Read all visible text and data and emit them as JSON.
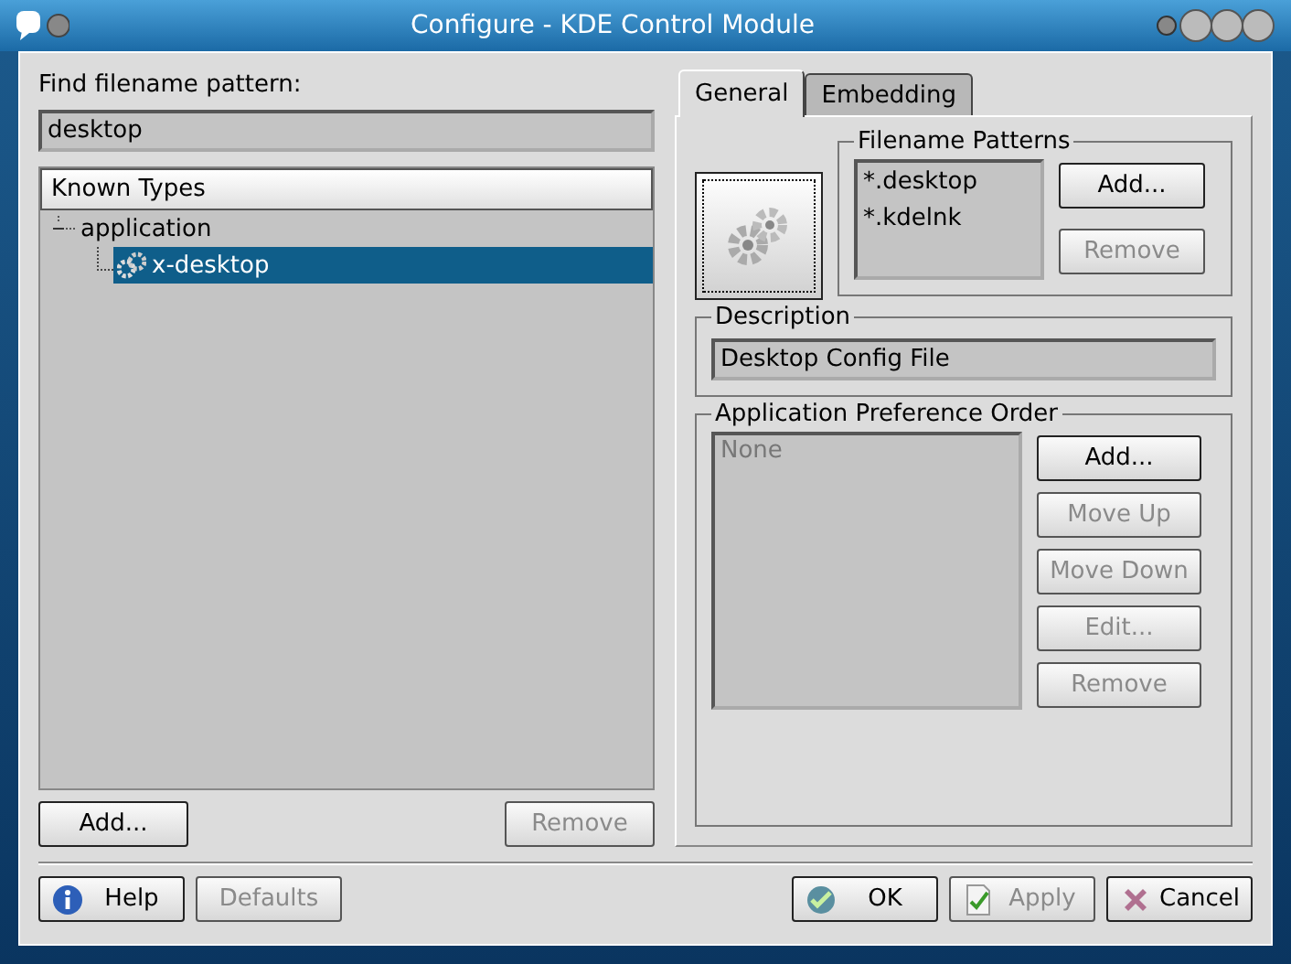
{
  "window": {
    "title": "Configure - KDE Control Module"
  },
  "find": {
    "label": "Find filename pattern:",
    "value": "desktop"
  },
  "tree": {
    "header": "Known Types",
    "items": [
      {
        "label": "application",
        "expanded": true,
        "children": [
          {
            "label": "x-desktop",
            "selected": true
          }
        ]
      }
    ]
  },
  "left_buttons": [
    {
      "label": "Add...",
      "disabled": false
    },
    {
      "label": "Remove",
      "disabled": true
    }
  ],
  "tabs": [
    {
      "label": "General",
      "selected": true
    },
    {
      "label": "Embedding",
      "selected": false
    }
  ],
  "patterns": {
    "title": "Filename Patterns",
    "items": [
      "*.desktop",
      "*.kdelnk"
    ],
    "buttons": [
      {
        "label": "Add...",
        "disabled": false
      },
      {
        "label": "Remove",
        "disabled": true
      }
    ]
  },
  "description": {
    "title": "Description",
    "value": "Desktop Config File"
  },
  "app_order": {
    "title": "Application Preference Order",
    "placeholder": "None",
    "buttons": [
      {
        "label": "Add...",
        "disabled": false
      },
      {
        "label": "Move Up",
        "disabled": true
      },
      {
        "label": "Move Down",
        "disabled": true
      },
      {
        "label": "Edit...",
        "disabled": true
      },
      {
        "label": "Remove",
        "disabled": true
      }
    ]
  },
  "footer_left": [
    {
      "label": "Help",
      "kind": "info",
      "disabled": false
    },
    {
      "label": "Defaults",
      "kind": "none",
      "disabled": true
    }
  ],
  "footer_right": [
    {
      "label": "OK",
      "kind": "ok",
      "disabled": false
    },
    {
      "label": "Apply",
      "kind": "apply",
      "disabled": true
    },
    {
      "label": "Cancel",
      "kind": "cancel",
      "disabled": false
    }
  ]
}
